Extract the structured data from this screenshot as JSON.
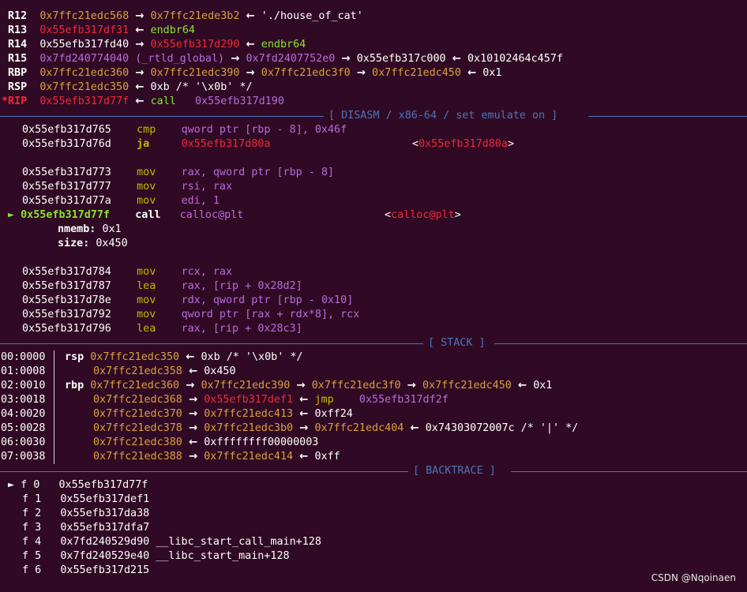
{
  "registers": {
    "r12": {
      "name": "R12",
      "addr": "0x7ffc21edc568",
      "arrow": "→",
      "target": "0x7ffc21ede3b2",
      "larrow": "←",
      "str": "'./house_of_cat'"
    },
    "r13": {
      "name": "R13",
      "addr": "0x55efb317df31",
      "larrow": "←",
      "instr": "endbr64"
    },
    "r14": {
      "name": "R14",
      "addr": "0x55efb317fd40",
      "arrow": "→",
      "target": "0x55efb317d290",
      "larrow": "←",
      "instr": "endbr64"
    },
    "r15": {
      "name": "R15",
      "addr": "0x7fd240774040",
      "sym": "(_rtld_global)",
      "arrow": "→",
      "t1": "0x7fd2407752e0",
      "arrow2": "→",
      "t2": "0x55efb317c000",
      "larrow": "←",
      "val": "0x10102464c457f"
    },
    "rbp": {
      "name": "RBP",
      "addr": "0x7ffc21edc360",
      "arrow": "→",
      "t1": "0x7ffc21edc390",
      "arrow2": "→",
      "t2": "0x7ffc21edc3f0",
      "arrow3": "→",
      "t3": "0x7ffc21edc450",
      "larrow": "←",
      "val": "0x1"
    },
    "rsp": {
      "name": "RSP",
      "addr": "0x7ffc21edc350",
      "larrow": "←",
      "val": "0xb /* '\\x0b' */"
    },
    "rip": {
      "name": "*RIP",
      "addr": "0x55efb317d77f",
      "larrow": "←",
      "instr": "call",
      "target": "0x55efb317d190"
    }
  },
  "sections": {
    "disasm": "[ DISASM / x86-64 / set emulate on ]",
    "stack": "[ STACK ]",
    "backtrace": "[ BACKTRACE ]"
  },
  "disasm": [
    {
      "addr": "0x55efb317d765",
      "op": "cmp",
      "a1": "qword ptr [rbp - ",
      "a2": "8",
      "a3": "], ",
      "a4": "0x46f"
    },
    {
      "addr": "0x55efb317d76d",
      "op": "ja",
      "target": "0x55efb317d80a",
      "lt": "<",
      "target2": "0x55efb317d80a",
      "gt": ">"
    },
    {
      "addr": "0x55efb317d773",
      "op": "mov",
      "a1": "rax, qword ptr [rbp - ",
      "a2": "8",
      "a3": "]"
    },
    {
      "addr": "0x55efb317d777",
      "op": "mov",
      "a1": "rsi, rax"
    },
    {
      "addr": "0x55efb317d77a",
      "op": "mov",
      "a1": "edi, ",
      "a2": "1"
    },
    {
      "marker": "►",
      "addr": "0x55efb317d77f",
      "op": "call",
      "a1": "calloc@plt",
      "lt": "<",
      "target": "calloc@plt",
      "gt": ">"
    },
    {
      "k": "nmemb:",
      "v": "0x1"
    },
    {
      "k": "size:",
      "v": "0x450"
    },
    {
      "addr": "0x55efb317d784",
      "op": "mov",
      "a1": "rcx, rax"
    },
    {
      "addr": "0x55efb317d787",
      "op": "lea",
      "a1": "rax, [rip + ",
      "a2": "0x28d2",
      "a3": "]"
    },
    {
      "addr": "0x55efb317d78e",
      "op": "mov",
      "a1": "rdx, qword ptr [rbp - ",
      "a2": "0x10",
      "a3": "]"
    },
    {
      "addr": "0x55efb317d792",
      "op": "mov",
      "a1": "qword ptr [rax + rdx*",
      "a2": "8",
      "a3": "], rcx"
    },
    {
      "addr": "0x55efb317d796",
      "op": "lea",
      "a1": "rax, [rip + ",
      "a2": "0x28c3",
      "a3": "]"
    }
  ],
  "stack": [
    {
      "off": "00:0000",
      "reg": "rsp",
      "addr": "0x7ffc21edc350",
      "larrow": "←",
      "val": "0xb /* '\\x0b' */"
    },
    {
      "off": "01:0008",
      "addr": "0x7ffc21edc358",
      "larrow": "←",
      "val": "0x450"
    },
    {
      "off": "02:0010",
      "reg": "rbp",
      "addr": "0x7ffc21edc360",
      "arrow": "→",
      "t1": "0x7ffc21edc390",
      "arrow2": "→",
      "t2": "0x7ffc21edc3f0",
      "arrow3": "→",
      "t3": "0x7ffc21edc450",
      "larrow": "←",
      "val": "0x1"
    },
    {
      "off": "03:0018",
      "addr": "0x7ffc21edc368",
      "arrow": "→",
      "t1": "0x55efb317def1",
      "larrow": "←",
      "instr": "jmp",
      "target": "0x55efb317df2f"
    },
    {
      "off": "04:0020",
      "addr": "0x7ffc21edc370",
      "arrow": "→",
      "t1": "0x7ffc21edc413",
      "larrow": "←",
      "val": "0xff24"
    },
    {
      "off": "05:0028",
      "addr": "0x7ffc21edc378",
      "arrow": "→",
      "t1": "0x7ffc21edc3b0",
      "arrow2": "→",
      "t2": "0x7ffc21edc404",
      "larrow": "←",
      "val": "0x74303072007c /* '|' */"
    },
    {
      "off": "06:0030",
      "addr": "0x7ffc21edc380",
      "larrow": "←",
      "val": "0xffffffff00000003"
    },
    {
      "off": "07:0038",
      "addr": "0x7ffc21edc388",
      "arrow": "→",
      "t1": "0x7ffc21edc414",
      "larrow": "←",
      "val": "0xff"
    }
  ],
  "backtrace": [
    {
      "marker": "►",
      "f": "f 0",
      "addr": "0x55efb317d77f",
      "sym": ""
    },
    {
      "f": "f 1",
      "addr": "0x55efb317def1",
      "sym": ""
    },
    {
      "f": "f 2",
      "addr": "0x55efb317da38",
      "sym": ""
    },
    {
      "f": "f 3",
      "addr": "0x55efb317dfa7",
      "sym": ""
    },
    {
      "f": "f 4",
      "addr": "0x7fd240529d90",
      "sym": "__libc_start_call_main+128"
    },
    {
      "f": "f 5",
      "addr": "0x7fd240529e40",
      "sym": "__libc_start_main+128"
    },
    {
      "f": "f 6",
      "addr": "0x55efb317d215",
      "sym": ""
    }
  ],
  "watermark": "CSDN @Nqoinaen",
  "colors": {
    "background": "#300a24",
    "dim": "#d9a13d",
    "red": "#ef2a36",
    "purple": "#b76cdb",
    "yellow": "#c4b900",
    "green": "#8ae234",
    "blue": "#4d73b9"
  }
}
